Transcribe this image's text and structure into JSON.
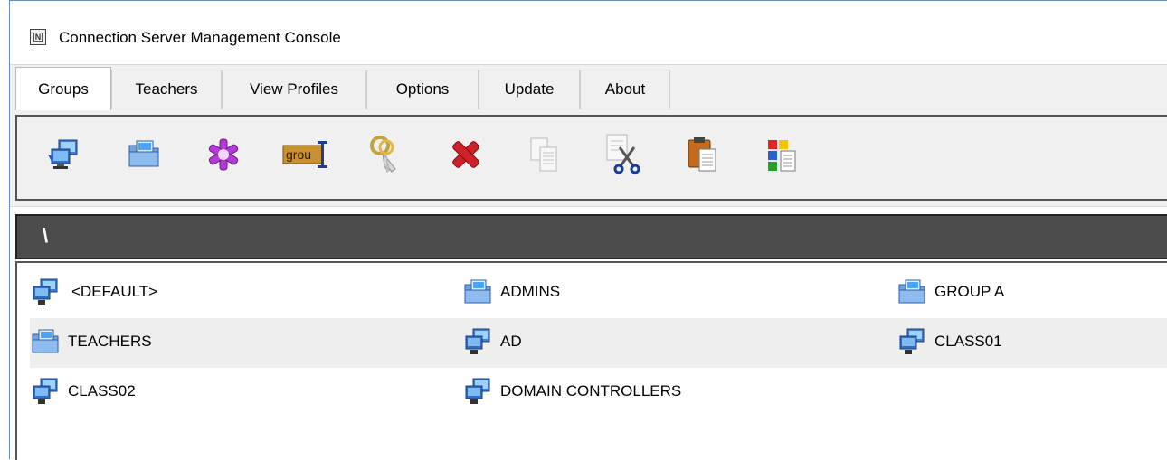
{
  "window": {
    "title": "Connection Server Management Console",
    "app_icon_glyph": "N"
  },
  "tabs": [
    {
      "label": "Groups",
      "active": true
    },
    {
      "label": "Teachers",
      "active": false
    },
    {
      "label": "View Profiles",
      "active": false
    },
    {
      "label": "Options",
      "active": false
    },
    {
      "label": "Update",
      "active": false
    },
    {
      "label": "About",
      "active": false
    }
  ],
  "toolbar": {
    "buttons": [
      {
        "icon": "add-group-icon",
        "enabled": true
      },
      {
        "icon": "group-folder-icon",
        "enabled": true
      },
      {
        "icon": "purple-asterisk-icon",
        "enabled": true
      },
      {
        "icon": "rename-icon",
        "text": "grou",
        "enabled": true
      },
      {
        "icon": "keys-icon",
        "enabled": true
      },
      {
        "icon": "delete-icon",
        "enabled": true
      },
      {
        "icon": "copy-icon",
        "enabled": false
      },
      {
        "icon": "cut-icon",
        "enabled": false
      },
      {
        "icon": "paste-icon",
        "enabled": true
      },
      {
        "icon": "colored-squares-icon",
        "enabled": true
      }
    ]
  },
  "path": "\\",
  "groups": [
    [
      {
        "name": "<DEFAULT>",
        "icon": "computers-icon"
      },
      {
        "name": "ADMINS",
        "icon": "group-folder-icon"
      },
      {
        "name": "GROUP A",
        "icon": "group-folder-icon"
      }
    ],
    [
      {
        "name": "TEACHERS",
        "icon": "group-folder-icon"
      },
      {
        "name": "AD",
        "icon": "computers-icon"
      },
      {
        "name": "CLASS01",
        "icon": "computers-icon"
      }
    ],
    [
      {
        "name": "CLASS02",
        "icon": "computers-icon"
      },
      {
        "name": "DOMAIN CONTROLLERS",
        "icon": "computers-icon"
      }
    ]
  ],
  "colors": {
    "path_bar": "#4c4c4c",
    "alt_row": "#eeeeee",
    "delete_red": "#d0202a",
    "asterisk_purple": "#b23ad6"
  }
}
